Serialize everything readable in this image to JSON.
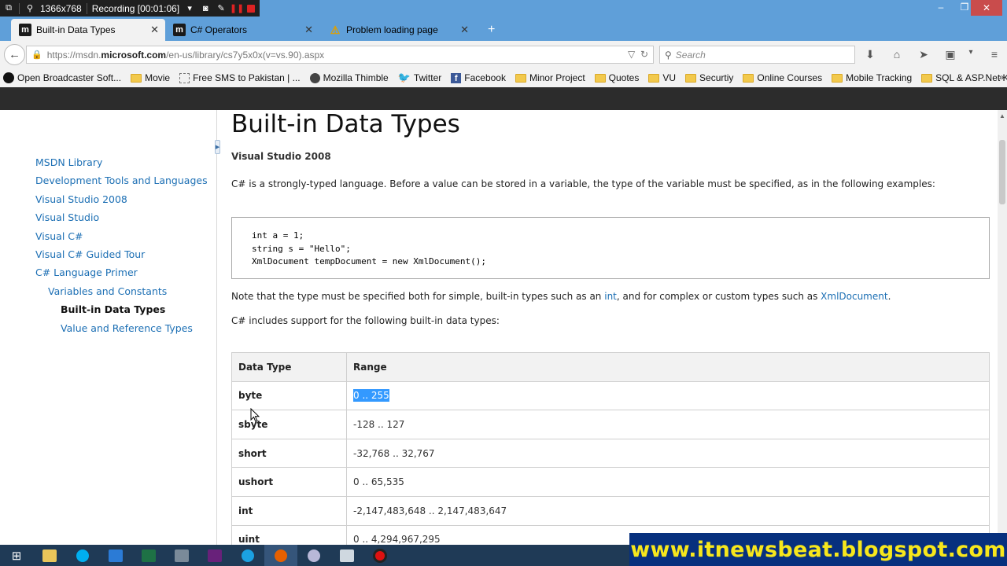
{
  "recorder": {
    "resolution": "1366x768",
    "status": "Recording [00:01:06]"
  },
  "tabs": [
    {
      "favicon": "m",
      "label": "Built-in Data Types"
    },
    {
      "favicon": "m",
      "label": "C# Operators"
    },
    {
      "favicon": "⚠",
      "label": "Problem loading page"
    }
  ],
  "window": {
    "minimize": "–",
    "restore": "❐",
    "close": "✕"
  },
  "nav": {
    "url_prefix": "https://msdn.",
    "url_domain": "microsoft.com",
    "url_path": "/en-us/library/cs7y5x0x(v=vs.90).aspx",
    "search_placeholder": "Search"
  },
  "bookmarks": [
    {
      "icon": "obs",
      "label": "Open Broadcaster Soft..."
    },
    {
      "icon": "folder",
      "label": "Movie"
    },
    {
      "icon": "dash",
      "label": "Free SMS to Pakistan | ..."
    },
    {
      "icon": "mozilla",
      "label": "Mozilla Thimble"
    },
    {
      "icon": "twitter",
      "label": "Twitter"
    },
    {
      "icon": "facebook",
      "label": "Facebook"
    },
    {
      "icon": "folder",
      "label": "Minor Project"
    },
    {
      "icon": "folder",
      "label": "Quotes"
    },
    {
      "icon": "folder",
      "label": "VU"
    },
    {
      "icon": "folder",
      "label": "Securtiy"
    },
    {
      "icon": "folder",
      "label": "Online Courses"
    },
    {
      "icon": "folder",
      "label": "Mobile Tracking"
    },
    {
      "icon": "folder",
      "label": "SQL & ASP.Net K-links"
    }
  ],
  "toc": [
    {
      "label": "MSDN Library",
      "level": 0
    },
    {
      "label": "Development Tools and Languages",
      "level": 0
    },
    {
      "label": "Visual Studio 2008",
      "level": 0
    },
    {
      "label": "Visual Studio",
      "level": 0
    },
    {
      "label": "Visual C#",
      "level": 0
    },
    {
      "label": "Visual C# Guided Tour",
      "level": 0
    },
    {
      "label": "C# Language Primer",
      "level": 0
    },
    {
      "label": "Variables and Constants",
      "level": 1
    },
    {
      "label": "Built-in Data Types",
      "level": 2,
      "current": true
    },
    {
      "label": "Value and Reference Types",
      "level": 2
    }
  ],
  "content": {
    "title": "Built-in Data Types",
    "version": "Visual Studio 2008",
    "intro": "C# is a strongly-typed language. Before a value can be stored in a variable, the type of the variable must be specified, as in the following examples:",
    "code_lines": [
      "int a = 1;",
      "string s = \"Hello\";",
      "XmlDocument tempDocument = new XmlDocument();"
    ],
    "note_part1": "Note that the type must be specified both for simple, built-in types such as an ",
    "note_link1": "int",
    "note_part2": ", and for complex or custom types such as ",
    "note_link2": "XmlDocument",
    "note_part3": ".",
    "support": "C# includes support for the following built-in data types:",
    "table": {
      "headers": [
        "Data Type",
        "Range"
      ],
      "rows": [
        {
          "type": "byte",
          "range": "0 .. 255",
          "selected": true
        },
        {
          "type": "sbyte",
          "range": "-128 .. 127"
        },
        {
          "type": "short",
          "range": "-32,768 .. 32,767"
        },
        {
          "type": "ushort",
          "range": "0 .. 65,535"
        },
        {
          "type": "int",
          "range": "-2,147,483,648 .. 2,147,483,647"
        },
        {
          "type": "uint",
          "range": "0 .. 4,294,967,295"
        }
      ]
    }
  },
  "watermark": "www.itnewsbeat.blogspot.com"
}
